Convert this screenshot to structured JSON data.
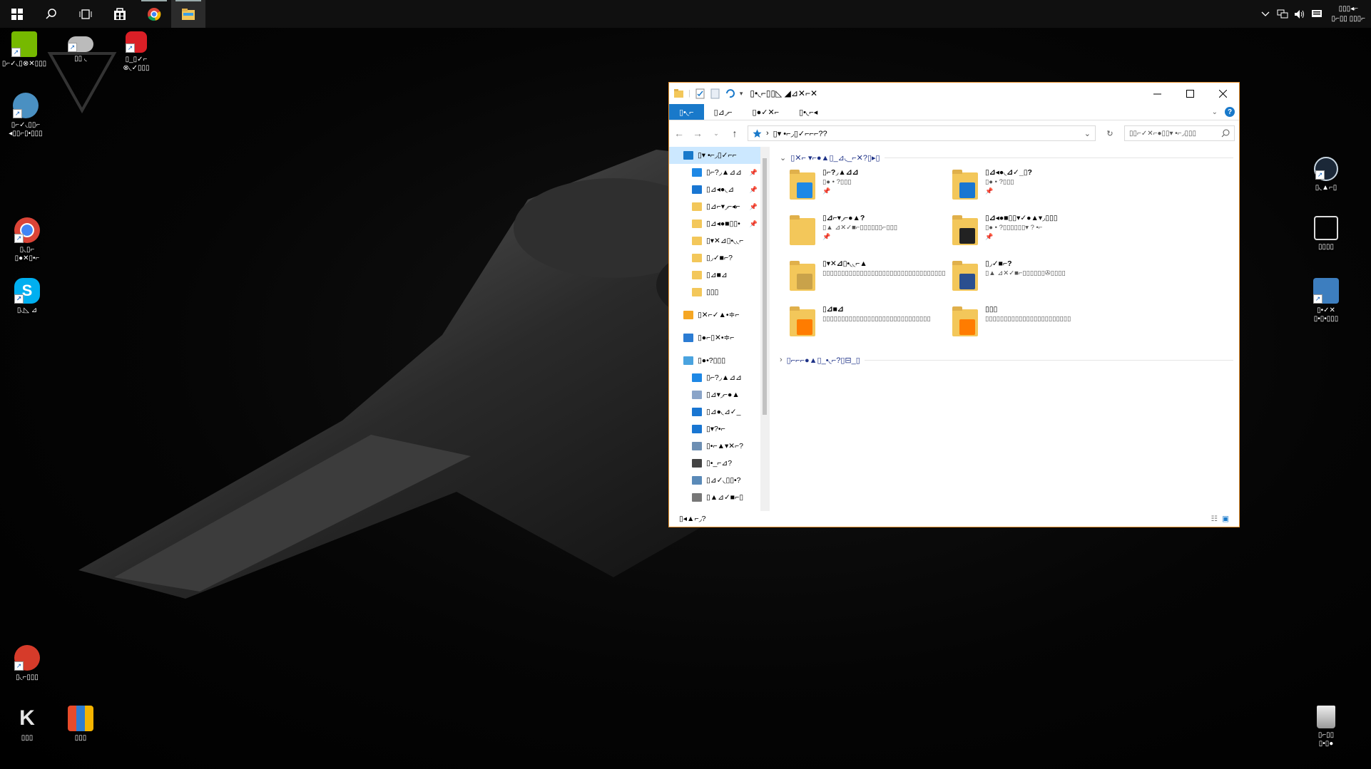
{
  "desktop": {
    "icons_left": [
      {
        "id": "geforce",
        "label": "▯⌐✓◟▯⊗✕▯▯▯",
        "color": "#76b900"
      },
      {
        "id": "gamepad",
        "label": "▯▯ ◟",
        "color": "#cccccc"
      },
      {
        "id": "adobe-cc",
        "label": "▯_▯✓⌐\n⊗◟✓▯▯▯",
        "color": "#da1f26"
      },
      {
        "id": "app-4",
        "label": "▯⌐✓◟▯▯⌐\n◂▯▯⌐▯•▯▯▯",
        "color": "#4a90c2"
      },
      {
        "id": "chrome",
        "label": "▯◟▯⌐\n▯●✕▯•⌐",
        "color": "#db4437"
      },
      {
        "id": "skype",
        "label": "▯◟◺ ⊿",
        "color": "#00aff0"
      },
      {
        "id": "ccleaner",
        "label": "▯◟⌐▯▯▯",
        "color": "#d63b2a"
      },
      {
        "id": "k-app",
        "label": "▯▯▯",
        "color": "#e5e5e5"
      },
      {
        "id": "app-winrar",
        "label": "▯▯▯",
        "color": "#e84b2a"
      }
    ],
    "icons_right": [
      {
        "id": "steam",
        "label": "▯◟▲⌐▯",
        "color": "#1b2838"
      },
      {
        "id": "app-r2",
        "label": "▯▯▯▯",
        "color": "#dddddd"
      },
      {
        "id": "app-r3",
        "label": "▯•✓✕\n▯•▯•▯▯▯",
        "color": "#3d7ebf"
      },
      {
        "id": "recycle-bin",
        "label": "▯⌐▯▯\n▯•▯●",
        "color": "#bbbbbb"
      }
    ]
  },
  "taskbar": {
    "buttons": [
      "start-icon",
      "search-icon",
      "task-view-icon",
      "store-icon",
      "chrome-icon",
      "file-explorer-icon"
    ],
    "tray_clock_time": "▯▯▯◂⌐",
    "tray_clock_date": "▯⌐▯▯ ▯▯▯⌐"
  },
  "explorer": {
    "title": "▯•◟⌐▯▯◺ ◢⊿✕⌐✕",
    "ribbon_tabs": [
      "▯•◟⌐",
      "▯⊿◞⌐",
      "▯●✓✕⌐",
      "▯•◟⌐◂"
    ],
    "address_path": "▯▾ •⌐◞▯✓⌐⌐⌐??",
    "search_placeholder": "▯▯⌐✓✕⌐●▯▯▾ •⌐◞▯▯▯",
    "nav_items": [
      {
        "label": "▯▾ •⌐◞▯✓⌐⌐",
        "icon": "quick-access",
        "color": "#1979ca",
        "kind": "top",
        "selected": true
      },
      {
        "label": "▯⌐?◞▲⊿⊿",
        "icon": "desktop",
        "color": "#1e88e5",
        "kind": "sub",
        "pin": "📌"
      },
      {
        "label": "▯⊿◂●◟⊿",
        "icon": "downloads",
        "color": "#1976d2",
        "kind": "sub",
        "pin": "📌"
      },
      {
        "label": "▯⊿⌐▾◞⌐◂⌐",
        "icon": "documents",
        "color": "#f3c75a",
        "kind": "sub",
        "pin": "📌"
      },
      {
        "label": "▯⊿◂●■▯▯•",
        "icon": "pictures",
        "color": "#f3c75a",
        "kind": "sub",
        "pin": "📌"
      },
      {
        "label": "▯▾✕⊿▯•◟◟⌐",
        "icon": "folder",
        "color": "#f3c75a",
        "kind": "sub"
      },
      {
        "label": "▯◞✓■⌐?",
        "icon": "folder",
        "color": "#f3c75a",
        "kind": "sub"
      },
      {
        "label": "▯⊿■⊿",
        "icon": "folder",
        "color": "#f3c75a",
        "kind": "sub"
      },
      {
        "label": "▯▯▯",
        "icon": "folder",
        "color": "#f3c75a",
        "kind": "sub"
      },
      {
        "label": "▯✕⌐✓▲•≑⌐",
        "icon": "creative-cloud",
        "color": "#f5a623",
        "kind": "top"
      },
      {
        "label": "▯●⌐▯✕•≑⌐",
        "icon": "onedrive",
        "color": "#2b7cd3",
        "kind": "top"
      },
      {
        "label": "▯●•?▯▯▯",
        "icon": "this-pc",
        "color": "#4aa3df",
        "kind": "top"
      },
      {
        "label": "▯⌐?◞▲⊿⊿",
        "icon": "desktop",
        "color": "#1e88e5",
        "kind": "sub"
      },
      {
        "label": "▯⊿▾◞⌐●▲",
        "icon": "documents",
        "color": "#8aa4c8",
        "kind": "sub"
      },
      {
        "label": "▯⊿●◟⊿✓_",
        "icon": "downloads",
        "color": "#1976d2",
        "kind": "sub"
      },
      {
        "label": "▯▾?•⌐",
        "icon": "music",
        "color": "#1976d2",
        "kind": "sub"
      },
      {
        "label": "▯•⌐▲▾✕⌐?",
        "icon": "pictures",
        "color": "#6d8fb3",
        "kind": "sub"
      },
      {
        "label": "▯•_⌐⊿?",
        "icon": "videos",
        "color": "#444444",
        "kind": "sub"
      },
      {
        "label": "▯⊿✓◟▯▯•?",
        "icon": "local-disk",
        "color": "#5a8ab8",
        "kind": "sub"
      },
      {
        "label": "▯▲⊿✓■⌐▯",
        "icon": "drive",
        "color": "#777777",
        "kind": "sub"
      }
    ],
    "group_frequent": "▯✕⌐ ▾⌐●▲▯_⊿◟_⌐✕?▯▸▯",
    "group_recent": "▯⌐⌐⌐●▲▯_•◟⌐?▯⊟_▯",
    "tiles": [
      {
        "name": "▯⌐?◞▲⊿⊿",
        "sub": "▯● • ?▯▯▯",
        "pin": "📌",
        "icon": "desktop-folder",
        "color": "#1e88e5"
      },
      {
        "name": "▯⊿◂●◟⊿✓_▯?",
        "sub": "▯● • ?▯▯▯",
        "pin": "📌",
        "icon": "downloads-folder",
        "color": "#1976d2"
      },
      {
        "name": "▯⊿⌐▾◞⌐●▲?",
        "sub": "▯▲ ⊿✕✓■⌐▯▯▯▯▯▯⌐▯▯▯",
        "pin": "📌",
        "icon": "documents-folder",
        "color": "#f3c75a"
      },
      {
        "name": "▯⊿◂●■▯▯▾✓●▲▾◞▯▯▯",
        "sub": "▯● • ?▯▯▯▯▯▯▾ ? •⌐",
        "pin": "📌",
        "icon": "pictures-folder",
        "color": "#222222"
      },
      {
        "name": "▯▾✕⊿▯•◟◟⌐▲",
        "sub": "▯▯▯▯▯▯▯▯▯▯▯▯▯▯▯▯▯▯▯▯▯▯▯▯▯▯▯▯▯▯▯▯▯",
        "pin": "",
        "icon": "game-folder",
        "color": "#c9a24a"
      },
      {
        "name": "▯◞✓■⌐?",
        "sub": "▯▲ ⊿✕✓■⌐▯▯▯▯▯▯✇▯▯▯▯",
        "pin": "",
        "icon": "movie-folder",
        "color": "#2a4f8f"
      },
      {
        "name": "▯⊿■⊿",
        "sub": "▯▯▯▯▯▯▯▯▯▯▯▯▯▯▯▯▯▯▯▯▯▯▯▯▯▯▯▯▯",
        "pin": "",
        "icon": "illustrator-folder",
        "color": "#ff7c00"
      },
      {
        "name": "▯▯▯",
        "sub": "▯▯▯▯▯▯▯▯▯▯▯▯▯▯▯▯▯▯▯▯▯▯▯",
        "pin": "",
        "icon": "illustrator-folder-2",
        "color": "#ff7c00"
      }
    ],
    "status_text": "▯◂▲⌐◞?"
  }
}
